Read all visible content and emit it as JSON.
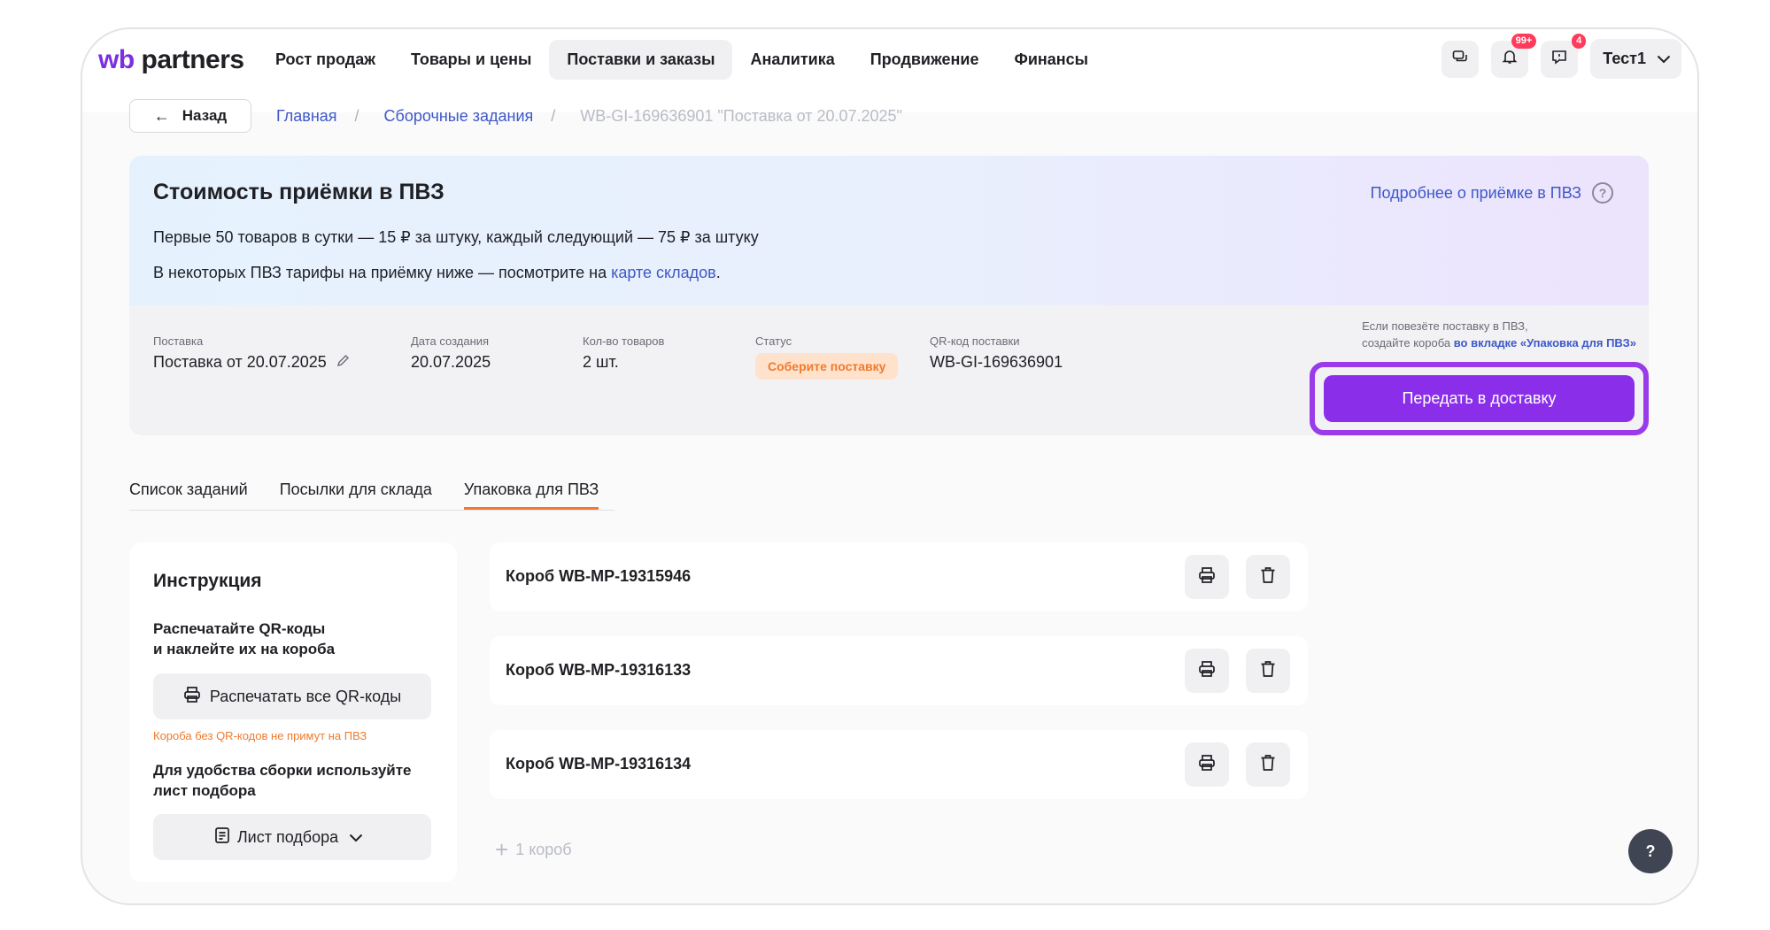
{
  "brand": {
    "logo_wb": "wb",
    "logo_partners": "partners"
  },
  "nav": {
    "items": [
      {
        "label": "Рост продаж"
      },
      {
        "label": "Товары и цены"
      },
      {
        "label": "Поставки и заказы",
        "active": true
      },
      {
        "label": "Аналитика"
      },
      {
        "label": "Продвижение"
      },
      {
        "label": "Финансы"
      }
    ]
  },
  "header_icons": {
    "chat_icon": "chat-icon",
    "bell_icon": "bell-icon",
    "bell_badge": "99+",
    "support_icon": "support-icon",
    "support_badge": "4",
    "user_name": "Тест1"
  },
  "breadcrumb": {
    "back_label": "Назад",
    "items": [
      "Главная",
      "Сборочные задания"
    ],
    "current": "WB-GI-169636901 \"Поставка от 20.07.2025\"",
    "separator": "/"
  },
  "banner": {
    "title": "Стоимость приёмки в ПВЗ",
    "line1": "Первые 50 товаров в сутки — 15 ₽ за штуку, каждый следующий — 75 ₽ за штуку",
    "line2_prefix": "В некоторых ПВЗ тарифы на приёмку ниже — посмотрите на ",
    "line2_link": "карте складов",
    "line2_suffix": ".",
    "more_link": "Подробнее о приёмке в ПВЗ",
    "help_glyph": "?"
  },
  "supply": {
    "name_label": "Поставка",
    "name_value": "Поставка от 20.07.2025",
    "created_label": "Дата создания",
    "created_value": "20.07.2025",
    "count_label": "Кол-во товаров",
    "count_value": "2 шт.",
    "status_label": "Статус",
    "status_value": "Соберите поставку",
    "qr_label": "QR-код поставки",
    "qr_value": "WB-GI-169636901",
    "hint_line1": "Если повезёте поставку в ПВЗ,",
    "hint_line2_prefix": "создайте короба ",
    "hint_line2_link": "во вкладке «Упаковка для ПВЗ»",
    "cta_label": "Передать в доставку"
  },
  "tabs": [
    {
      "label": "Список заданий"
    },
    {
      "label": "Посылки для склада"
    },
    {
      "label": "Упаковка для ПВЗ",
      "active": true
    }
  ],
  "instruction": {
    "title": "Инструкция",
    "step1_line1": "Распечатайте QR-коды",
    "step1_line2": "и наклейте их на короба",
    "print_all_label": "Распечатать все QR-коды",
    "warning": "Короба без QR-кодов не примут на ПВЗ",
    "step2": "Для удобства сборки используйте лист подбора",
    "pick_list_label": "Лист подбора"
  },
  "boxes": [
    {
      "name": "Короб WB-MP-19315946"
    },
    {
      "name": "Короб WB-MP-19316133"
    },
    {
      "name": "Короб WB-MP-19316134"
    }
  ],
  "add_box_label": "1 короб",
  "help_fab_label": "?",
  "colors": {
    "accent": "#8a2eea",
    "link": "#3e58c8",
    "status_bg": "#ffe2cc",
    "status_text": "#f07a2d",
    "badge": "#ff3b5c"
  }
}
